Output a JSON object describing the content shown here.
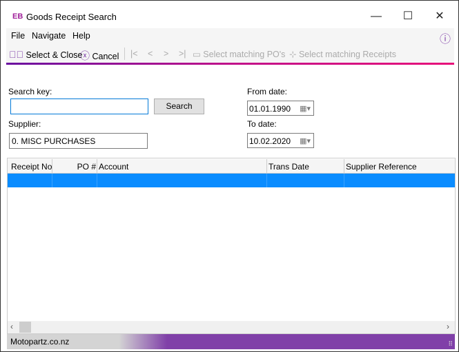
{
  "window": {
    "logo": "EB",
    "title": "Goods Receipt Search",
    "minimize": "—",
    "maximize": "☐",
    "close": "✕"
  },
  "menu": {
    "items": [
      "File",
      "Navigate",
      "Help"
    ],
    "info_icon": "ⓘ"
  },
  "toolbar": {
    "select_close": "Select & Close",
    "cancel": "Cancel",
    "first": "|<",
    "prev": "<",
    "next": ">",
    "last": ">|",
    "select_pos": "Select matching PO's",
    "select_receipts": "Select matching Receipts"
  },
  "form": {
    "search_key_label": "Search key:",
    "search_key_value": "",
    "search_button": "Search",
    "supplier_label": "Supplier:",
    "supplier_value": "0. MISC PURCHASES",
    "from_date_label": "From date:",
    "from_date": "01.01.1990",
    "to_date_label": "To date:",
    "to_date": "10.02.2020"
  },
  "grid": {
    "columns": [
      "Receipt No",
      "PO #",
      "Account",
      "Trans Date",
      "Supplier Reference"
    ],
    "selected_color": "#0a8cff"
  },
  "status": {
    "text": "Motopartz.co.nz",
    "accent": "#8040a8"
  }
}
